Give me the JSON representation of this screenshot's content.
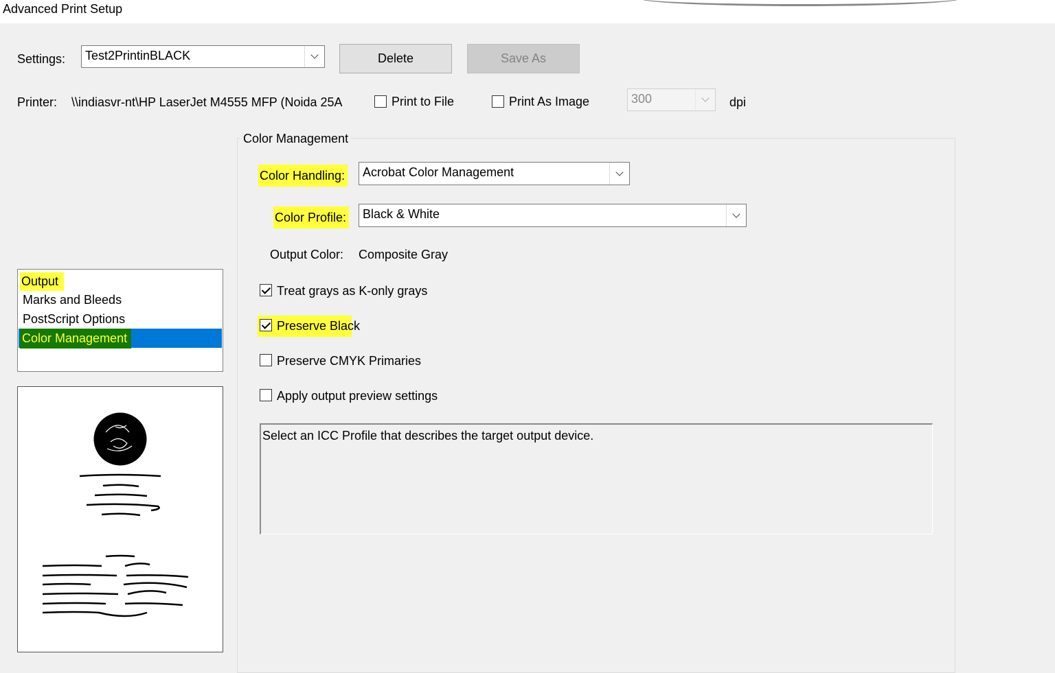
{
  "window": {
    "title": "Advanced Print Setup"
  },
  "settings": {
    "label": "Settings:",
    "value": "Test2PrintinBLACK",
    "delete_label": "Delete",
    "save_as_label": "Save As"
  },
  "printer": {
    "label": "Printer:",
    "name": "\\\\indiasvr-nt\\HP LaserJet M4555 MFP (Noida 25A",
    "print_to_file_label": "Print to File",
    "print_to_file_checked": false,
    "print_as_image_label": "Print As Image",
    "print_as_image_checked": false,
    "dpi_value": "300",
    "dpi_label": "dpi"
  },
  "nav": {
    "items": [
      {
        "label": "Output"
      },
      {
        "label": "Marks and Bleeds"
      },
      {
        "label": "PostScript Options"
      },
      {
        "label": "Color Management",
        "selected": true
      }
    ]
  },
  "color_management": {
    "group_title": "Color Management",
    "color_handling_label": "Color Handling:",
    "color_handling_value": "Acrobat Color Management",
    "color_profile_label": "Color Profile:",
    "color_profile_value": "Black & White",
    "output_color_label": "Output Color:",
    "output_color_value": "Composite Gray",
    "options": [
      {
        "label": "Treat grays as K-only grays",
        "checked": true
      },
      {
        "label": "Preserve Black",
        "checked": true
      },
      {
        "label": "Preserve CMYK Primaries",
        "checked": false
      },
      {
        "label": "Apply output preview settings",
        "checked": false
      }
    ],
    "description": "Select an ICC Profile that describes the target output device."
  },
  "colors": {
    "highlight": "#ffff3a",
    "selection": "#0078d7",
    "selection_text_bg": "#147a00"
  }
}
